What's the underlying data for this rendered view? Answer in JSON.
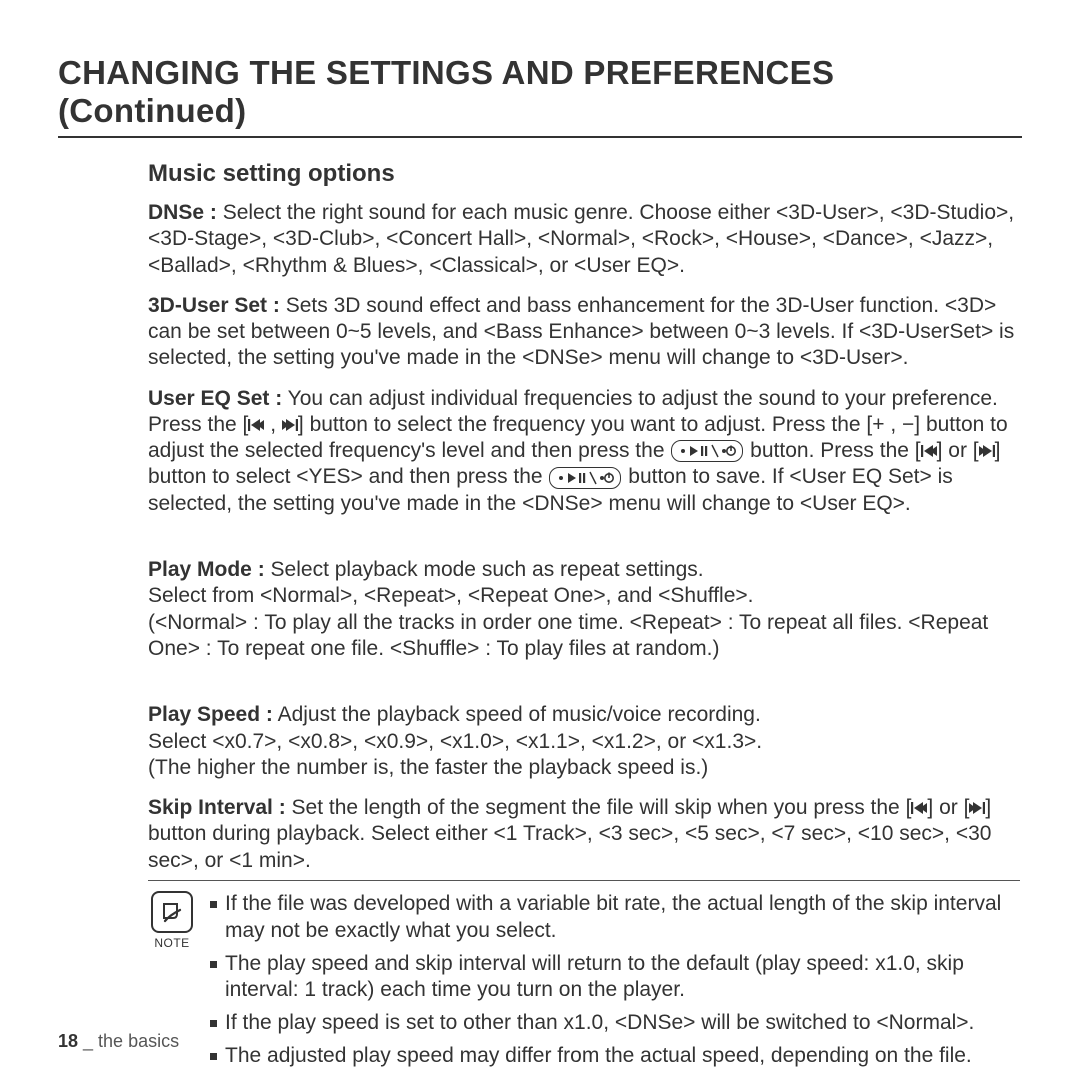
{
  "title": "CHANGING THE SETTINGS AND PREFERENCES (Continued)",
  "subtitle": "Music setting options",
  "p": {
    "dnse_b": "DNSe :",
    "dnse_t": " Select the right sound for each music genre. Choose either <3D-User>, <3D-Studio>, <3D-Stage>, <3D-Club>, <Concert Hall>, <Normal>, <Rock>, <House>, <Dance>, <Jazz>, <Ballad>, <Rhythm & Blues>, <Classical>, or <User EQ>.",
    "tduser_b": "3D-User Set :",
    "tduser_t": " Sets 3D sound effect and bass enhancement for the 3D-User function. <3D> can be set between 0~5 levels, and <Bass Enhance> between 0~3 levels. If <3D-UserSet> is selected, the setting you've made in the <DNSe> menu will change to <3D-User>.",
    "usereq_b": "User EQ Set :",
    "usereq_1": " You can adjust individual frequencies to adjust the sound to your preference. Press the [",
    "usereq_2": "] button to select the frequency you want to adjust. Press the [",
    "usereq_3": "] button to adjust the selected frequency's level and then press the ",
    "usereq_4": " button. Press the [",
    "usereq_5": "] or [",
    "usereq_6": "] button to select <YES> and then press the ",
    "usereq_7": " button to save. If <User EQ Set> is selected, the setting you've made in the <DNSe> menu will change to <User EQ>.",
    "plus_minus": "+ , −",
    "prev_next_sep": " , ",
    "playmode_b": "Play Mode :",
    "playmode_t": " Select playback mode such as repeat settings.\nSelect from <Normal>, <Repeat>, <Repeat One>, and <Shuffle>.\n(<Normal> : To play all the tracks in order one time. <Repeat> : To repeat all files. <Repeat One> : To repeat one file.  <Shuffle> : To play files at random.)",
    "playspeed_b": "Play Speed :",
    "playspeed_t": " Adjust the playback speed of music/voice recording.\nSelect <x0.7>, <x0.8>, <x0.9>, <x1.0>, <x1.1>, <x1.2>, or <x1.3>.\n(The higher the number is, the faster the playback speed is.)",
    "skip_b": "Skip Interval :",
    "skip_1": " Set the length of the segment the file will skip when you press the [",
    "skip_or": "] or [",
    "skip_2": "] button during playback. Select either <1 Track>, <3 sec>, <5 sec>, <7 sec>, <10 sec>, <30 sec>, or <1 min>."
  },
  "note_label": "NOTE",
  "notes": {
    "n1": "If the file was developed with a variable bit rate, the actual length of the skip interval may not be exactly what you select.",
    "n2": "The play speed and skip interval will return to the default (play speed: x1.0, skip interval: 1 track) each time you turn on the player.",
    "n3": "If the play speed is set to other than x1.0, <DNSe> will be switched to <Normal>.",
    "n4": "The adjusted play speed may differ from the actual speed, depending on the file."
  },
  "footer_page": "18",
  "footer_sep": " _ ",
  "footer_section": "the basics",
  "icons": {
    "prev": "previous-track-icon",
    "next": "next-track-icon",
    "playpause": "play-pause-power-button-icon",
    "note": "note-icon"
  }
}
